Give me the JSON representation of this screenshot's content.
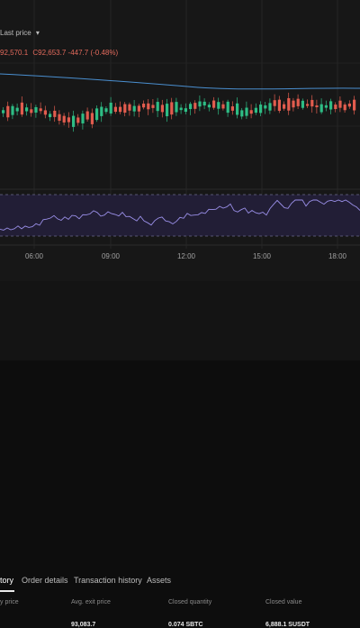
{
  "chart": {
    "price_type_label": "Last price",
    "ohlc": {
      "o_value": "92,570.1",
      "c_label": "C",
      "c_value": "92,653.7",
      "change": "-447.7",
      "change_pct": "(-0.48%)"
    },
    "time_labels": [
      "06:00",
      "09:00",
      "12:00",
      "15:00",
      "18:00"
    ],
    "colors": {
      "up": "#2ebd85",
      "down": "#e25c4e",
      "ma": "#4a8fd0",
      "rsi_line": "#9a8fe8",
      "rsi_band": "#221e36"
    }
  },
  "chart_data": {
    "type": "candlestick",
    "x": [
      "06:00",
      "09:00",
      "12:00",
      "15:00",
      "18:00"
    ],
    "close": [
      92570.1,
      92653.7
    ],
    "change": -447.7,
    "change_pct": -0.48
  },
  "tabs": [
    {
      "label": "tory",
      "active": true
    },
    {
      "label": "Order details",
      "active": false
    },
    {
      "label": "Transaction history",
      "active": false
    },
    {
      "label": "Assets",
      "active": false
    }
  ],
  "table": {
    "headers": [
      "y price",
      "Avg. exit price",
      "Closed quantity",
      "Closed value"
    ],
    "row": [
      "",
      "93,083.7",
      "0.074 SBTC",
      "6,888.1 SUSDT"
    ]
  }
}
